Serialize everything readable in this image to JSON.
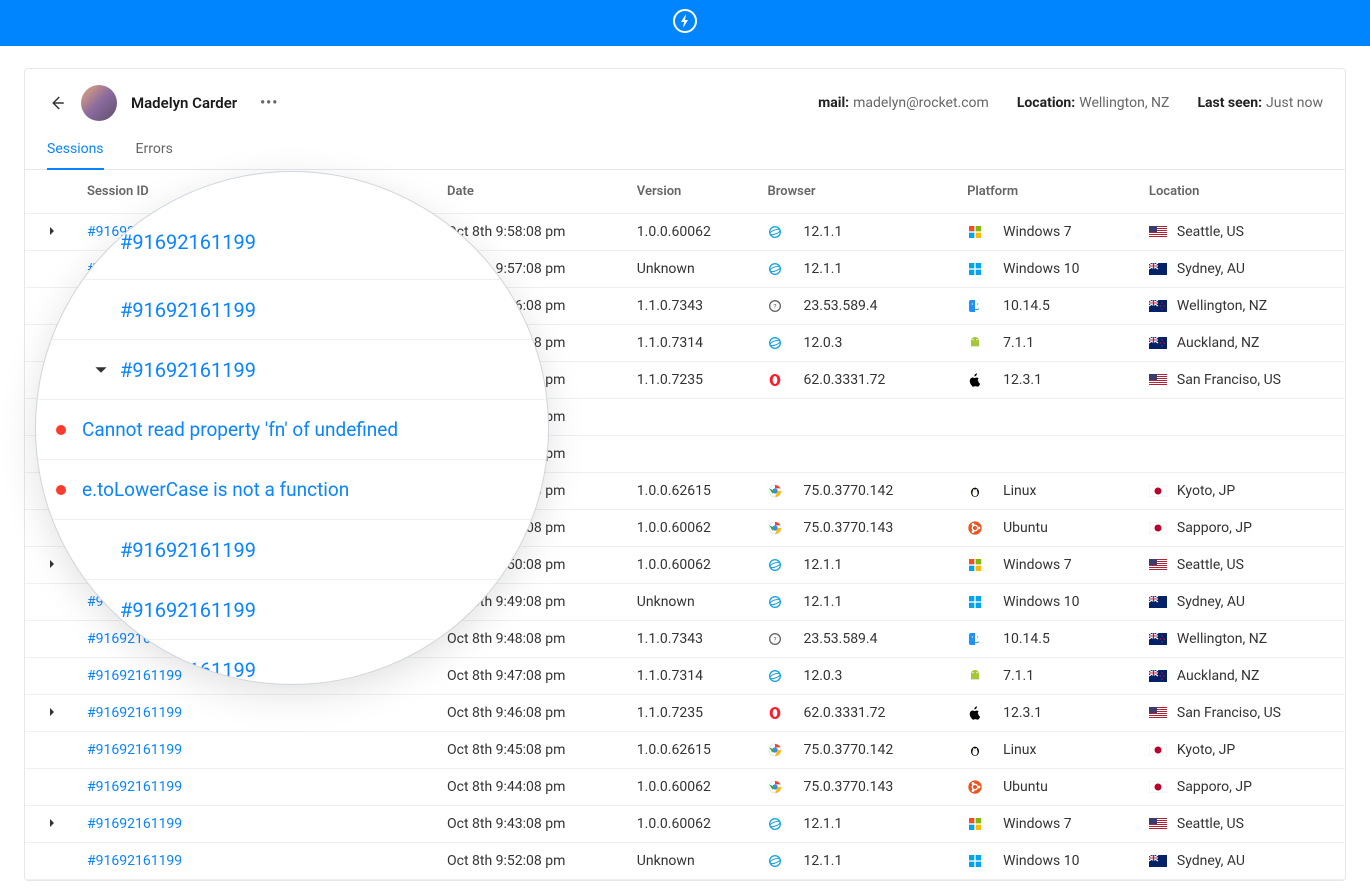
{
  "header": {
    "user_name": "Madelyn Carder",
    "mail_label": "mail:",
    "mail_value": "madelyn@rocket.com",
    "location_label": "Location:",
    "location_value": "Wellington, NZ",
    "lastseen_label": "Last seen:",
    "lastseen_value": "Just now"
  },
  "tabs": {
    "sessions": "Sessions",
    "errors": "Errors"
  },
  "columns": {
    "session_id": "Session ID",
    "date": "Date",
    "version": "Version",
    "browser": "Browser",
    "platform": "Platform",
    "location": "Location"
  },
  "rows": [
    {
      "id": "#91692161199",
      "expandable": true,
      "date": "Oct 8th 9:58:08 pm",
      "version": "1.0.0.60062",
      "browser": "12.1.1",
      "browser_icon": "ie",
      "platform": "Windows 7",
      "platform_icon": "win7",
      "location": "Seattle, US",
      "flag": "us"
    },
    {
      "id": "#91692161199",
      "expandable": false,
      "date": "Oct 8th 9:57:08 pm",
      "version": "Unknown",
      "browser": "12.1.1",
      "browser_icon": "ie",
      "platform": "Windows 10",
      "platform_icon": "win10",
      "location": "Sydney, AU",
      "flag": "au"
    },
    {
      "id": "#91692161199",
      "expandable": false,
      "date": "Oct 8th 9:56:08 pm",
      "version": "1.1.0.7343",
      "browser": "23.53.589.4",
      "browser_icon": "unknown",
      "platform": "10.14.5",
      "platform_icon": "finder",
      "location": "Wellington, NZ",
      "flag": "nz"
    },
    {
      "id": "#91692161199",
      "expandable": false,
      "date": "Oct 8th 9:55:08 pm",
      "version": "1.1.0.7314",
      "browser": "12.0.3",
      "browser_icon": "ie",
      "platform": "7.1.1",
      "platform_icon": "android",
      "location": "Auckland, NZ",
      "flag": "nz"
    },
    {
      "id": "#91692161199",
      "expandable": false,
      "date": "Oct 8th 9:54:08 pm",
      "version": "1.1.0.7235",
      "browser": "62.0.3331.72",
      "browser_icon": "opera",
      "platform": "12.3.1",
      "platform_icon": "apple",
      "location": "San Franciso, US",
      "flag": "us"
    },
    {
      "id": "#91692161199",
      "expandable": false,
      "date": "Oct 8th 9:53:08 pm",
      "version": "",
      "browser": "",
      "browser_icon": "",
      "platform": "",
      "platform_icon": "",
      "location": "",
      "flag": ""
    },
    {
      "id": "#91692161199",
      "expandable": false,
      "date": "Oct 8th 9:54:08 pm",
      "version": "",
      "browser": "",
      "browser_icon": "",
      "platform": "",
      "platform_icon": "",
      "location": "",
      "flag": ""
    },
    {
      "id": "#91692161199",
      "expandable": false,
      "date": "Oct 8th 9:52:08 pm",
      "version": "1.0.0.62615",
      "browser": "75.0.3770.142",
      "browser_icon": "chrome",
      "platform": "Linux",
      "platform_icon": "linux",
      "location": "Kyoto, JP",
      "flag": "jp"
    },
    {
      "id": "#91692161199",
      "expandable": false,
      "date": "Oct 8th 9:51:08 pm",
      "version": "1.0.0.60062",
      "browser": "75.0.3770.143",
      "browser_icon": "chrome",
      "platform": "Ubuntu",
      "platform_icon": "ubuntu",
      "location": "Sapporo, JP",
      "flag": "jp"
    },
    {
      "id": "#91692161199",
      "expandable": true,
      "date": "Oct 8th 9:50:08 pm",
      "version": "1.0.0.60062",
      "browser": "12.1.1",
      "browser_icon": "ie",
      "platform": "Windows 7",
      "platform_icon": "win7",
      "location": "Seattle, US",
      "flag": "us"
    },
    {
      "id": "#91692161199",
      "expandable": false,
      "date": "Oct 8th 9:49:08 pm",
      "version": "Unknown",
      "browser": "12.1.1",
      "browser_icon": "ie",
      "platform": "Windows 10",
      "platform_icon": "win10",
      "location": "Sydney, AU",
      "flag": "au"
    },
    {
      "id": "#91692161199",
      "expandable": false,
      "date": "Oct 8th 9:48:08 pm",
      "version": "1.1.0.7343",
      "browser": "23.53.589.4",
      "browser_icon": "unknown",
      "platform": "10.14.5",
      "platform_icon": "finder",
      "location": "Wellington, NZ",
      "flag": "nz"
    },
    {
      "id": "#91692161199",
      "expandable": false,
      "date": "Oct 8th 9:47:08 pm",
      "version": "1.1.0.7314",
      "browser": "12.0.3",
      "browser_icon": "ie",
      "platform": "7.1.1",
      "platform_icon": "android",
      "location": "Auckland, NZ",
      "flag": "nz"
    },
    {
      "id": "#91692161199",
      "expandable": true,
      "date": "Oct 8th 9:46:08 pm",
      "version": "1.1.0.7235",
      "browser": "62.0.3331.72",
      "browser_icon": "opera",
      "platform": "12.3.1",
      "platform_icon": "apple",
      "location": "San Franciso, US",
      "flag": "us"
    },
    {
      "id": "#91692161199",
      "expandable": false,
      "date": "Oct 8th 9:45:08 pm",
      "version": "1.0.0.62615",
      "browser": "75.0.3770.142",
      "browser_icon": "chrome",
      "platform": "Linux",
      "platform_icon": "linux",
      "location": "Kyoto, JP",
      "flag": "jp"
    },
    {
      "id": "#91692161199",
      "expandable": false,
      "date": "Oct 8th 9:44:08 pm",
      "version": "1.0.0.60062",
      "browser": "75.0.3770.143",
      "browser_icon": "chrome",
      "platform": "Ubuntu",
      "platform_icon": "ubuntu",
      "location": "Sapporo, JP",
      "flag": "jp"
    },
    {
      "id": "#91692161199",
      "expandable": true,
      "date": "Oct 8th 9:43:08 pm",
      "version": "1.0.0.60062",
      "browser": "12.1.1",
      "browser_icon": "ie",
      "platform": "Windows 7",
      "platform_icon": "win7",
      "location": "Seattle, US",
      "flag": "us"
    },
    {
      "id": "#91692161199",
      "expandable": false,
      "date": "Oct 8th 9:52:08 pm",
      "version": "Unknown",
      "browser": "12.1.1",
      "browser_icon": "ie",
      "platform": "Windows 10",
      "platform_icon": "win10",
      "location": "Sydney, AU",
      "flag": "au"
    }
  ],
  "zoom": {
    "s1": "#91692161199",
    "s2": "#91692161199",
    "s3": "#91692161199",
    "err1": "Cannot read property 'fn' of undefined",
    "err2": "e.toLowerCase is not a function",
    "s4": "#91692161199",
    "s5": "#91692161199",
    "s6": "#91692161199"
  }
}
